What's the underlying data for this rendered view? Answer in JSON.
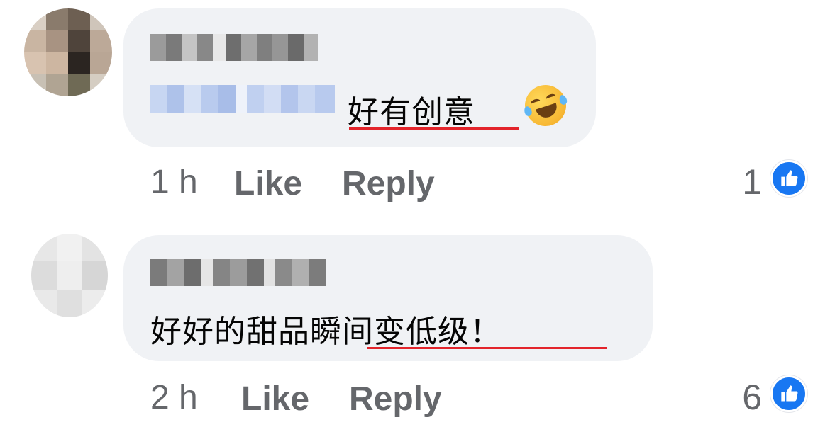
{
  "comments": [
    {
      "text": "好有创意",
      "emoji": "rolling-on-floor-laughing-emoji",
      "time": "1 h",
      "like_label": "Like",
      "reply_label": "Reply",
      "reaction_count": "1"
    },
    {
      "text": "好好的甜品瞬间变低级！",
      "time": "2 h",
      "like_label": "Like",
      "reply_label": "Reply",
      "reaction_count": "6"
    }
  ],
  "colors": {
    "bubble": "#f0f2f5",
    "text": "#050505",
    "meta": "#65676b",
    "like_blue": "#1877f2",
    "underline_red": "#e3242b"
  }
}
